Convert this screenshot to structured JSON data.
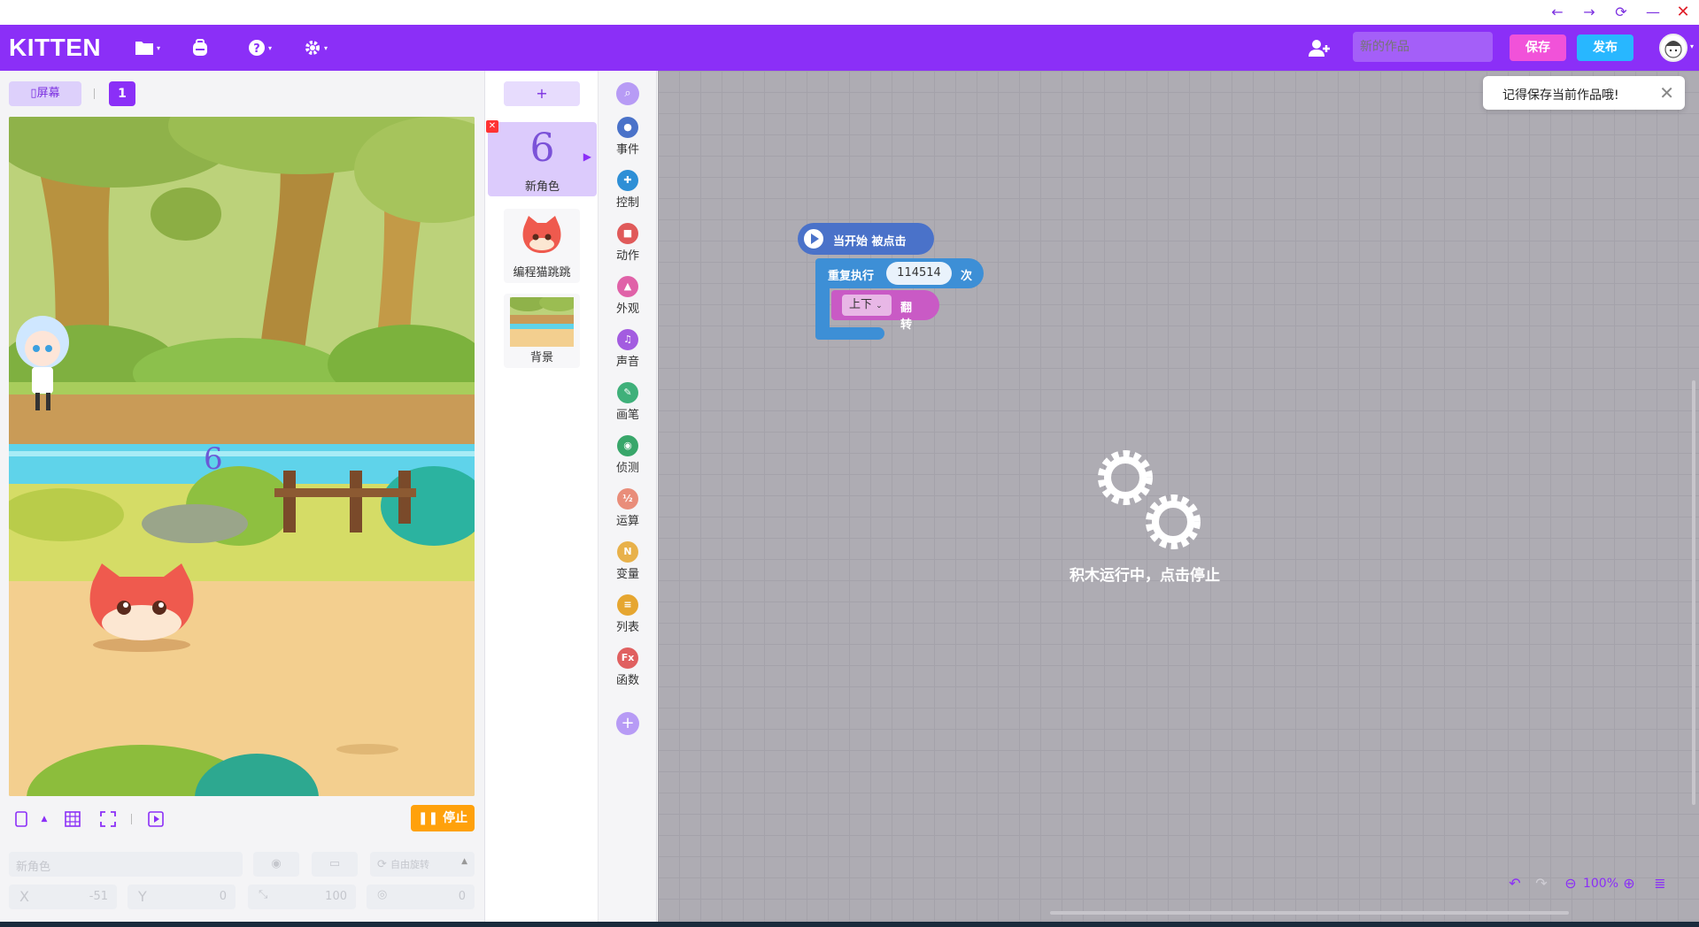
{
  "window": {
    "back_icon": "←",
    "forward_icon": "→",
    "refresh_icon": "⟳",
    "minimize_icon": "—",
    "close_icon": "✕"
  },
  "header": {
    "logo": "KITTEN",
    "project_title_placeholder": "新的作品",
    "save_label": "保存",
    "publish_label": "发布"
  },
  "stage_panel": {
    "screen_label": "屏幕",
    "screen_number": "1",
    "stop_label": "停止",
    "sprite_name_placeholder": "新角色",
    "rotation_label": "自由旋转",
    "x_label": "X",
    "x_value": "-51",
    "y_label": "Y",
    "y_value": "0",
    "size_value": "100",
    "direction_value": "0"
  },
  "sprites": {
    "add_label": "+",
    "selected": {
      "glyph": "6",
      "name": "新角色"
    },
    "items": [
      {
        "name": "编程猫跳跳"
      },
      {
        "name": "背景"
      }
    ]
  },
  "categories": [
    {
      "label": "事件",
      "color": "#4a72c9",
      "glyph": "●"
    },
    {
      "label": "控制",
      "color": "#2e8fd6",
      "glyph": "✚"
    },
    {
      "label": "动作",
      "color": "#e05a5a",
      "glyph": "■"
    },
    {
      "label": "外观",
      "color": "#e062a8",
      "glyph": "▲"
    },
    {
      "label": "声音",
      "color": "#a35ce0",
      "glyph": "♫"
    },
    {
      "label": "画笔",
      "color": "#3fb07a",
      "glyph": "✎"
    },
    {
      "label": "侦测",
      "color": "#38a66a",
      "glyph": "◉"
    },
    {
      "label": "运算",
      "color": "#e98d7a",
      "glyph": "½"
    },
    {
      "label": "变量",
      "color": "#e8b14a",
      "glyph": "N"
    },
    {
      "label": "列表",
      "color": "#e6a630",
      "glyph": "≡"
    },
    {
      "label": "函数",
      "color": "#e06060",
      "glyph": "Fx"
    }
  ],
  "workspace": {
    "toast_message": "记得保存当前作品哦!",
    "hat_block_label": "当开始 被点击",
    "repeat_label": "重复执行",
    "repeat_count": "114514",
    "repeat_suffix": "次",
    "flip_option": "上下",
    "flip_label": "翻转",
    "running_message": "积木运行中，点击停止",
    "zoom_level": "100%"
  },
  "colors": {
    "brand_purple": "#8b2ff7",
    "save_pink": "#f152d9",
    "publish_blue": "#28b7ff",
    "stop_orange": "#ffa10b"
  }
}
